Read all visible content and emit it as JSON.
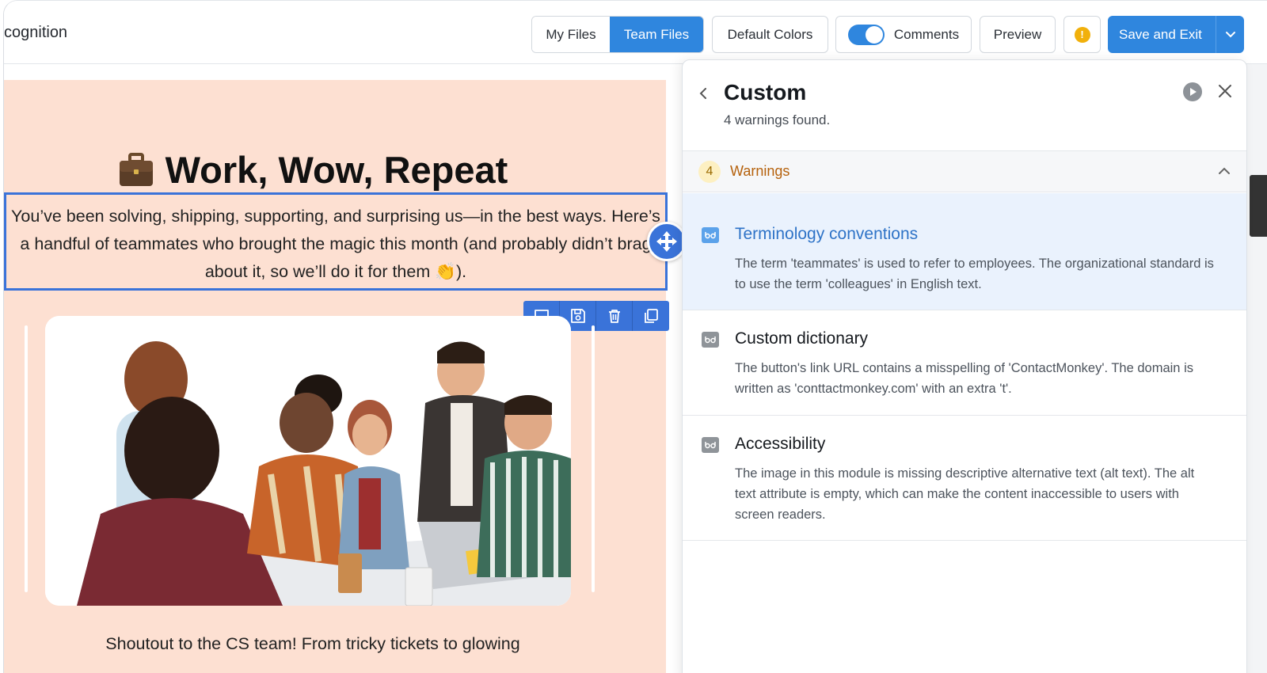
{
  "app": {
    "title": "cognition"
  },
  "toolbar": {
    "my_files": "My Files",
    "team_files": "Team Files",
    "default_colors": "Default Colors",
    "comments": "Comments",
    "comments_enabled": true,
    "preview": "Preview",
    "alert_glyph": "!",
    "save_exit": "Save and Exit",
    "accent_color": "#2f86de"
  },
  "email": {
    "headline": "Work, Wow, Repeat",
    "headline_icon": "briefcase-icon",
    "body_text": "You’ve been solving, shipping, supporting, and surprising us—in the best ways. Here’s a handful of teammates who brought the magic this month (and probably didn’t brag about it, so we’ll do it for them 👏).",
    "caption": "Shoutout to the CS team! From tricky tickets to glowing",
    "background_color": "#fde0d2",
    "module_tools": [
      "comment-icon",
      "save-icon",
      "trash-icon",
      "duplicate-icon"
    ]
  },
  "panel": {
    "title": "Custom",
    "subtitle": "4 warnings found.",
    "section": {
      "count": "4",
      "label": "Warnings"
    },
    "warnings": [
      {
        "title": "Terminology conventions",
        "description": "The term 'teammates' is used to refer to employees. The organizational standard is to use the term 'colleagues' in English text.",
        "active": true
      },
      {
        "title": "Custom dictionary",
        "description": "The button's link URL contains a misspelling of 'ContactMonkey'. The domain is written as 'conttactmonkey.com' with an extra 't'.",
        "active": false
      },
      {
        "title": "Accessibility",
        "description": "The image in this module is missing descriptive alternative text (alt text). The alt text attribute is empty, which can make the content inaccessible to users with screen readers.",
        "active": false
      }
    ]
  }
}
